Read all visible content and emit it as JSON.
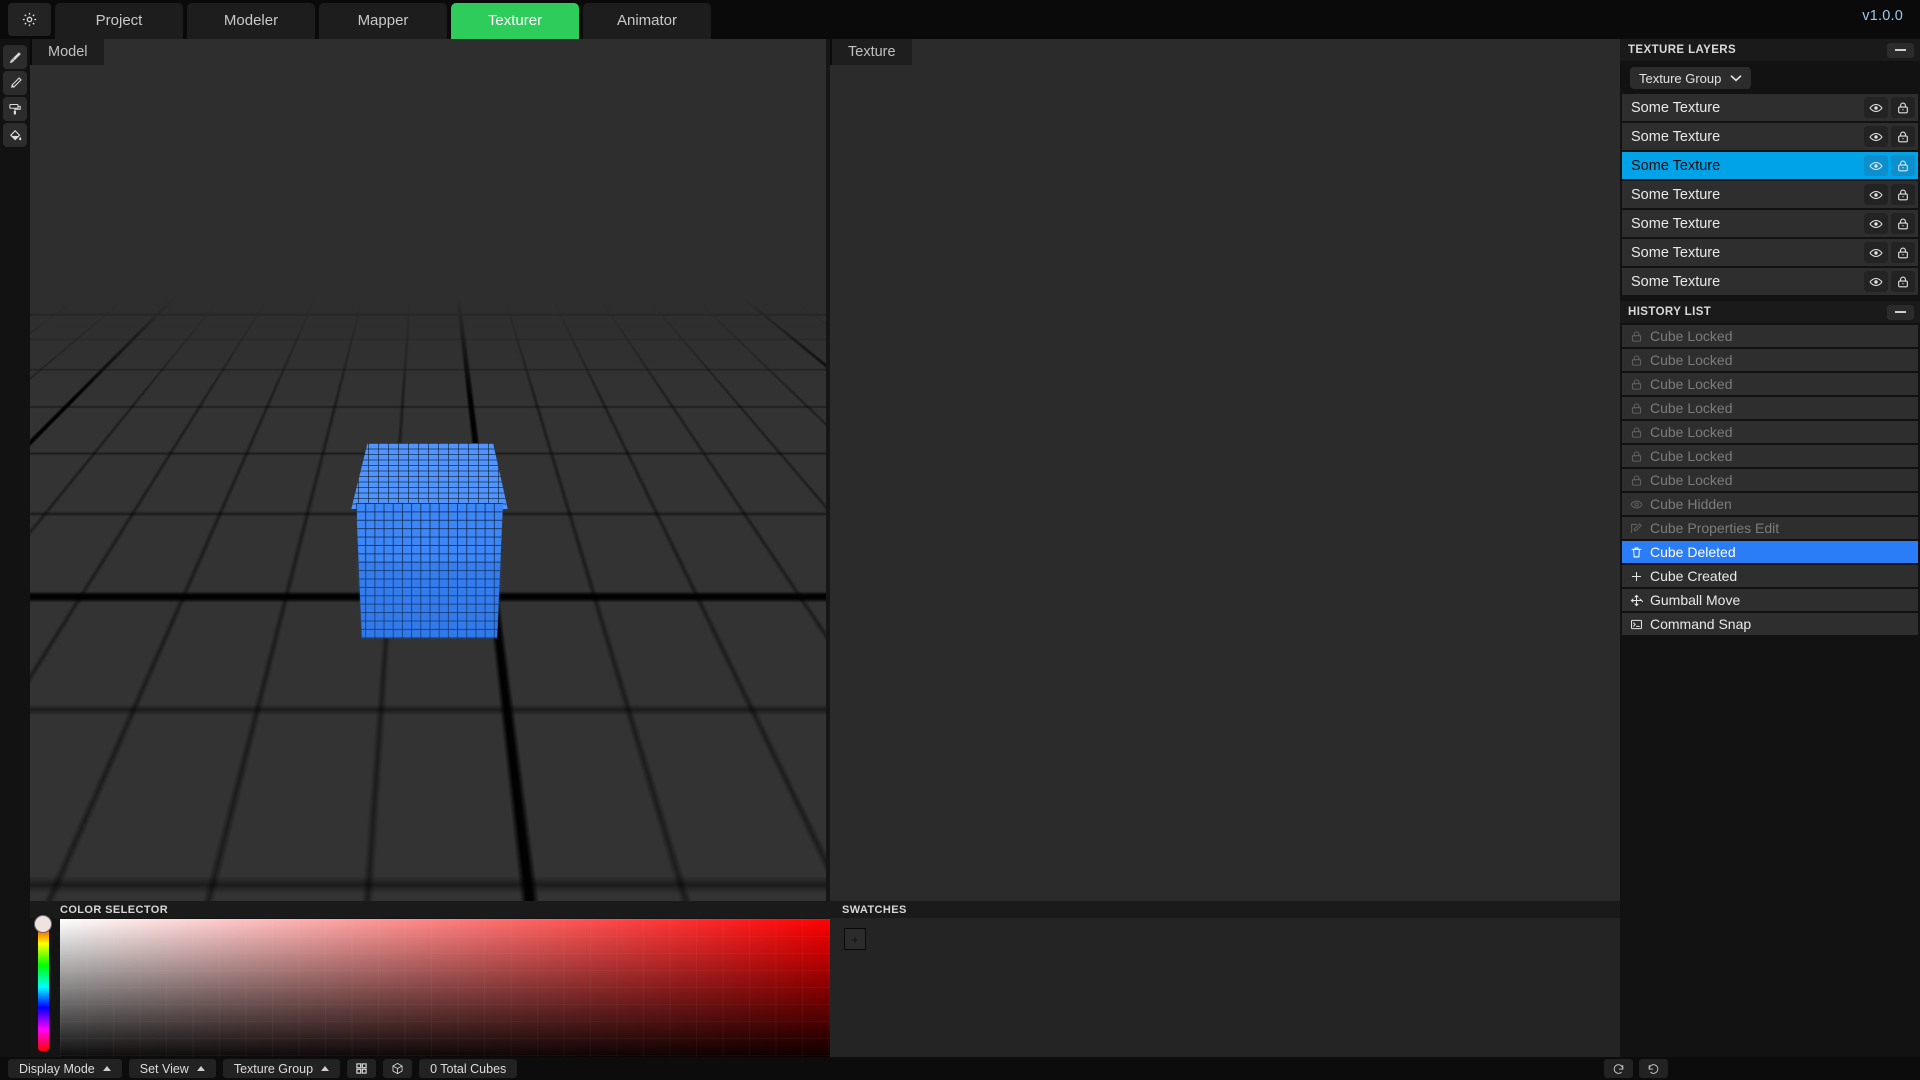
{
  "app": {
    "version": "v1.0.0",
    "accent_green": "#2ECC5B",
    "accent_blue_layer": "#00A2E8",
    "accent_blue_history": "#2b7cf7",
    "cube_color": "#3d86f7"
  },
  "topbar": {
    "settings_icon": "gear-icon",
    "tabs": [
      {
        "label": "Project",
        "active": false
      },
      {
        "label": "Modeler",
        "active": false
      },
      {
        "label": "Mapper",
        "active": false
      },
      {
        "label": "Texturer",
        "active": true
      },
      {
        "label": "Animator",
        "active": false
      }
    ]
  },
  "toolrail": {
    "tools": [
      {
        "name": "paintbrush-icon",
        "label": "Paint Brush"
      },
      {
        "name": "pencil-icon",
        "label": "Pencil"
      },
      {
        "name": "paint-roller-icon",
        "label": "Paint Roller"
      },
      {
        "name": "paint-bucket-icon",
        "label": "Paint Bucket"
      }
    ]
  },
  "viewports": {
    "model_tab": "Model",
    "texture_tab": "Texture"
  },
  "color_selector": {
    "title": "COLOR SELECTOR",
    "hue_handle_position_pct": 11
  },
  "swatches": {
    "title": "SWATCHES",
    "add_label": "+"
  },
  "texture_layers": {
    "title": "TEXTURE LAYERS",
    "minimize_icon": "minimize-icon",
    "group_selector": {
      "label": "Texture Group",
      "chevron": "chevron-down-icon"
    },
    "layers": [
      {
        "name": "Some Texture",
        "selected": false,
        "visible": true,
        "locked": true
      },
      {
        "name": "Some Texture",
        "selected": false,
        "visible": true,
        "locked": true
      },
      {
        "name": "Some Texture",
        "selected": true,
        "visible": true,
        "locked": true
      },
      {
        "name": "Some Texture",
        "selected": false,
        "visible": true,
        "locked": true
      },
      {
        "name": "Some Texture",
        "selected": false,
        "visible": true,
        "locked": true
      },
      {
        "name": "Some Texture",
        "selected": false,
        "visible": true,
        "locked": true
      },
      {
        "name": "Some Texture",
        "selected": false,
        "visible": true,
        "locked": true
      }
    ]
  },
  "history_list": {
    "title": "HISTORY LIST",
    "minimize_icon": "minimize-icon",
    "entries": [
      {
        "label": "Cube Locked",
        "icon": "lock-icon",
        "state": "undone",
        "selected": false
      },
      {
        "label": "Cube Locked",
        "icon": "lock-icon",
        "state": "undone",
        "selected": false
      },
      {
        "label": "Cube Locked",
        "icon": "lock-icon",
        "state": "undone",
        "selected": false
      },
      {
        "label": "Cube Locked",
        "icon": "lock-icon",
        "state": "undone",
        "selected": false
      },
      {
        "label": "Cube Locked",
        "icon": "lock-icon",
        "state": "undone",
        "selected": false
      },
      {
        "label": "Cube Locked",
        "icon": "lock-icon",
        "state": "undone",
        "selected": false
      },
      {
        "label": "Cube Locked",
        "icon": "lock-icon",
        "state": "undone",
        "selected": false
      },
      {
        "label": "Cube Hidden",
        "icon": "eye-icon",
        "state": "undone",
        "selected": false
      },
      {
        "label": "Cube Properties Edit",
        "icon": "edit-icon",
        "state": "undone",
        "selected": false
      },
      {
        "label": "Cube Deleted",
        "icon": "trash-icon",
        "state": "current",
        "selected": true
      },
      {
        "label": "Cube Created",
        "icon": "plus-icon",
        "state": "active",
        "selected": false
      },
      {
        "label": "Gumball Move",
        "icon": "move-icon",
        "state": "active",
        "selected": false
      },
      {
        "label": "Command Snap",
        "icon": "console-icon",
        "state": "active",
        "selected": false
      }
    ]
  },
  "statusbar": {
    "display_mode": "Display Mode",
    "set_view": "Set View",
    "texture_group": "Texture Group",
    "grid_icon": "grid-icon",
    "cube_icon": "cube-icon",
    "cube_count": "0 Total Cubes",
    "undo_icon": "undo-icon",
    "redo_icon": "redo-icon"
  }
}
